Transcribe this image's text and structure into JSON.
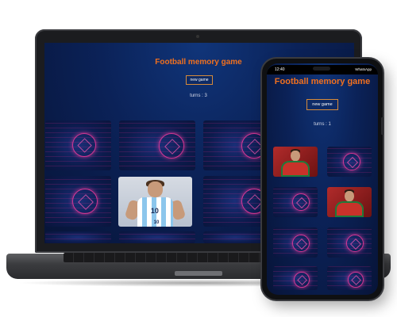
{
  "laptop": {
    "title": "Football memory game",
    "new_game_label": "new game",
    "turns_text": "turns : 3"
  },
  "phone": {
    "status_time": "12:40",
    "status_app": "WhatsApp",
    "title": "Football memory game",
    "new_game_label": "new game",
    "turns_text": "turns : 1"
  },
  "colors": {
    "title": "#f0701f",
    "background": "#0b2258",
    "button_border": "#d68b3a",
    "card_glow": "#ff3ca0"
  },
  "icons": {
    "card_back": "football-icon",
    "flipped_laptop": "messi-player-image",
    "flipped_phone": "ronaldo-player-image"
  },
  "laptop_cards": {
    "visible_count": 9,
    "flipped_index": 4
  },
  "phone_cards": {
    "visible_count": 8,
    "flipped_indices": [
      0,
      3
    ]
  }
}
